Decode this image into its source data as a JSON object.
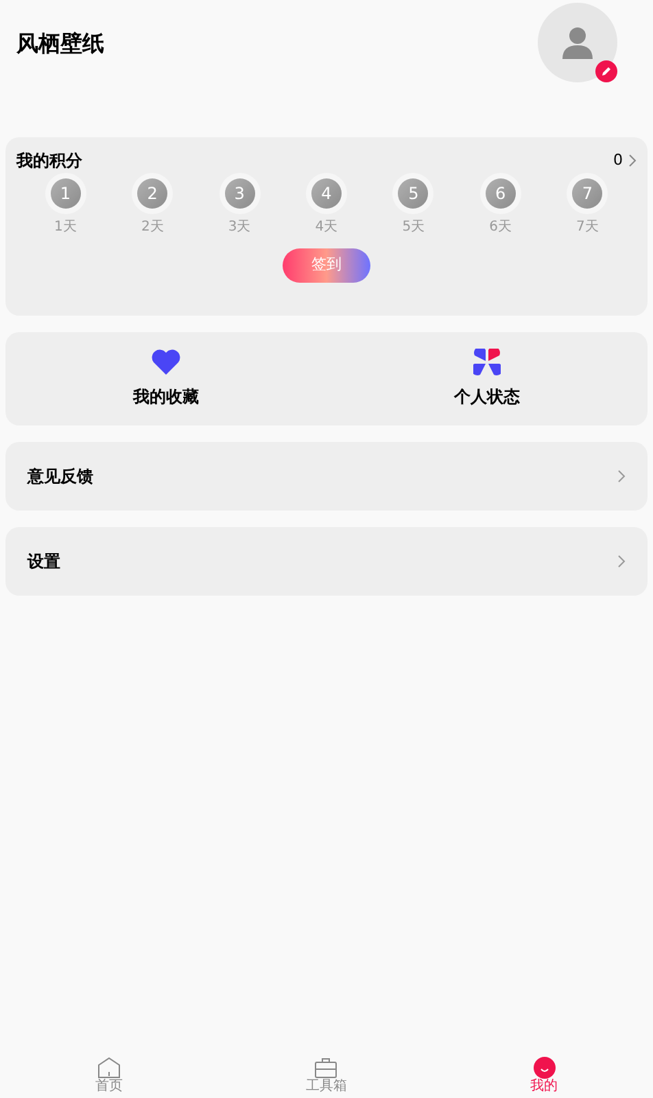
{
  "app_title": "风栖壁纸",
  "points": {
    "title": "我的积分",
    "count": "0",
    "days": [
      {
        "number": "1",
        "label": "1天"
      },
      {
        "number": "2",
        "label": "2天"
      },
      {
        "number": "3",
        "label": "3天"
      },
      {
        "number": "4",
        "label": "4天"
      },
      {
        "number": "5",
        "label": "5天"
      },
      {
        "number": "6",
        "label": "6天"
      },
      {
        "number": "7",
        "label": "7天"
      }
    ],
    "checkin_button": "签到"
  },
  "shortcuts": [
    {
      "kind": "heart",
      "label": "我的收藏"
    },
    {
      "kind": "clover",
      "label": "个人状态"
    }
  ],
  "menu": [
    {
      "label": "意见反馈"
    },
    {
      "label": "设置"
    }
  ],
  "tabs": [
    {
      "kind": "home",
      "label": "首页",
      "selected": false
    },
    {
      "kind": "toolbox",
      "label": "工具箱",
      "selected": false
    },
    {
      "kind": "smile",
      "label": "我的",
      "selected": true
    }
  ]
}
